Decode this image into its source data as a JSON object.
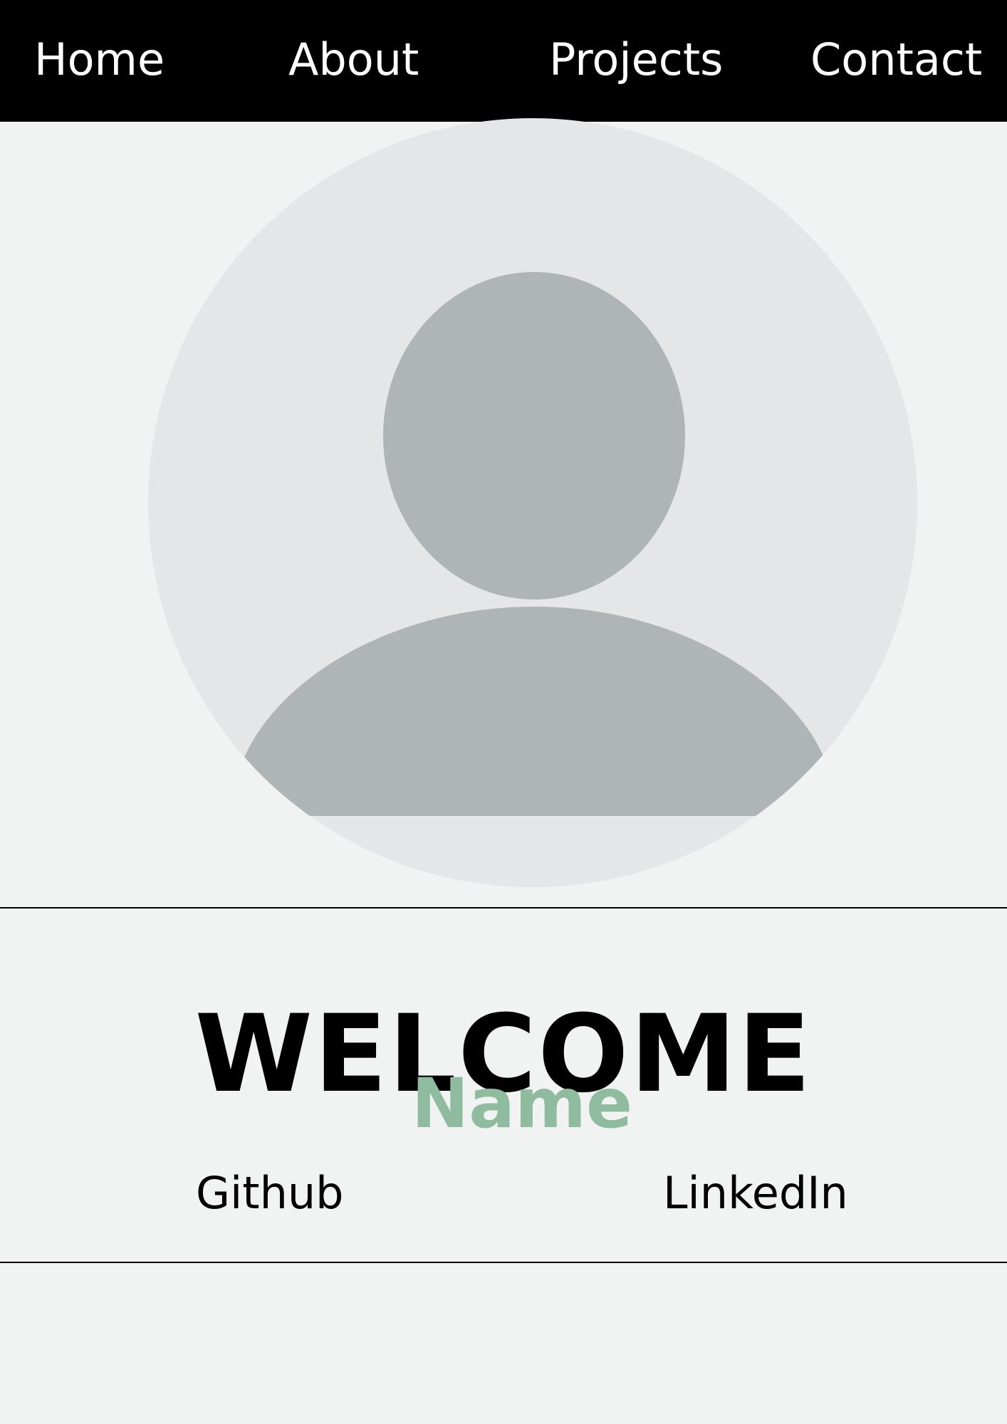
{
  "nav": {
    "items": [
      {
        "label": "Home"
      },
      {
        "label": "About"
      },
      {
        "label": "Projects"
      },
      {
        "label": "Contact"
      }
    ]
  },
  "avatar": {
    "icon": "user-placeholder-icon"
  },
  "hero": {
    "title": "WELCOME",
    "name": "Name"
  },
  "social": {
    "github_label": "Github",
    "linkedin_label": "LinkedIn"
  },
  "colors": {
    "page_background": "#f1f3f2",
    "nav_background": "#000000",
    "nav_text": "#ffffff",
    "name_accent": "#8fbc9f",
    "avatar_circle": "#e4e6e7",
    "avatar_silhouette": "#afb4b7",
    "text_dark": "#000000"
  }
}
